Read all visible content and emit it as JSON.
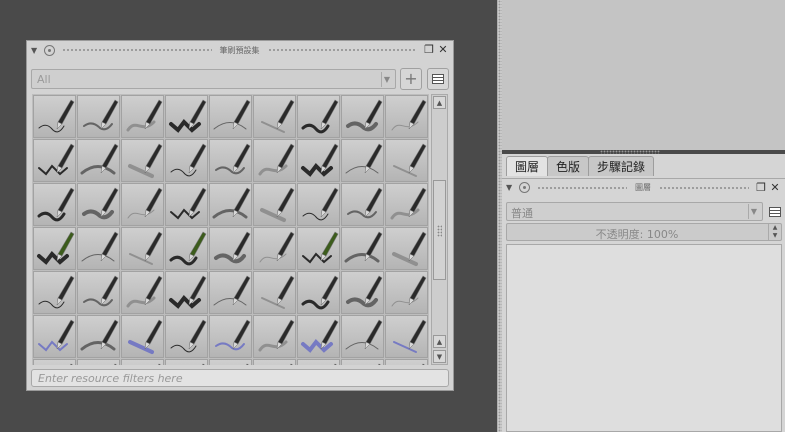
{
  "preset_docker": {
    "title": "筆刷預設集",
    "filter_value": "All",
    "add_button_label": "+",
    "resource_filter_placeholder": "Enter resource filters here",
    "preset_count": 63
  },
  "right_docker": {
    "tabs": [
      {
        "label": "圖層",
        "active": true
      },
      {
        "label": "色版",
        "active": false
      },
      {
        "label": "步驟記錄",
        "active": false
      }
    ],
    "layers_title": "圖層",
    "blend_mode": "普通",
    "opacity_text": "不透明度:  100%"
  },
  "icons": [
    "collapse-arrow-icon",
    "lock-icon",
    "float-icon",
    "close-icon",
    "list-view-icon",
    "scroll-up-icon",
    "scroll-down-icon",
    "combo-arrow-icon"
  ]
}
